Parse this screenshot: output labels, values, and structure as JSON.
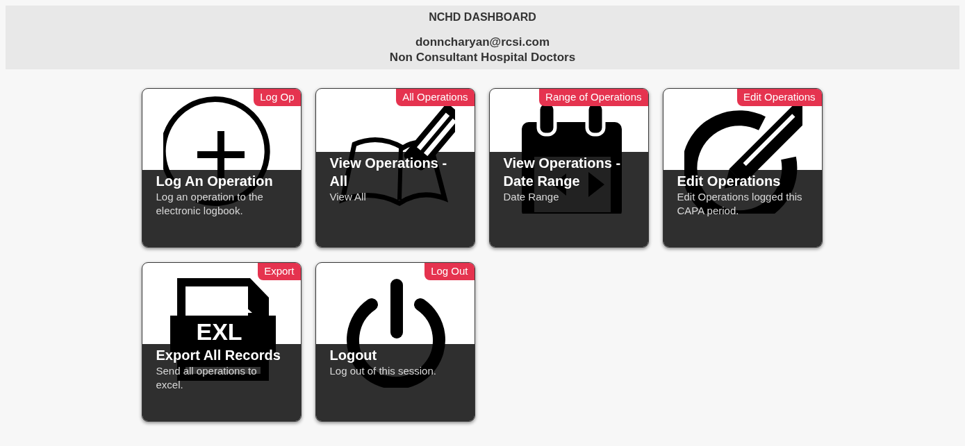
{
  "header": {
    "title": "NCHD DASHBOARD",
    "email": "donncharyan@rcsi.com",
    "subtitle": "Non Consultant Hospital Doctors"
  },
  "tiles": [
    {
      "kind": "add",
      "badge": "Log Op",
      "title": "Log An Operation",
      "description": "Log an operation to the electronic logbook."
    },
    {
      "kind": "book",
      "badge": "All Operations",
      "title": "View Operations - All",
      "description": "View All"
    },
    {
      "kind": "calendar",
      "badge": "Range of Operations",
      "title": "View Operations - Date Range",
      "description": "Date Range"
    },
    {
      "kind": "edit",
      "badge": "Edit Operations",
      "title": "Edit Operations",
      "description": "Edit Operations logged this CAPA period."
    },
    {
      "kind": "file",
      "badge": "Export",
      "title": "Export All Records",
      "description": "Send all operations to excel.",
      "icon_text": "EXL"
    },
    {
      "kind": "power",
      "badge": "Log Out",
      "title": "Logout",
      "description": "Log out of this session."
    }
  ]
}
